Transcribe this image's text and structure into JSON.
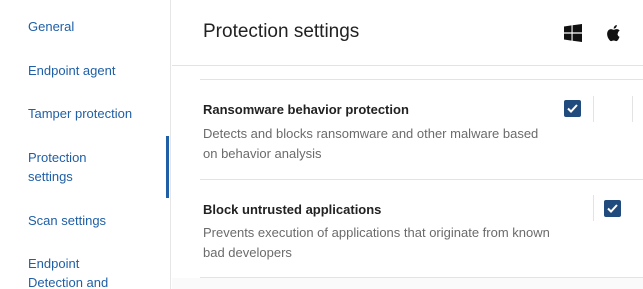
{
  "sidebar": {
    "items": [
      {
        "label": "General"
      },
      {
        "label": "Endpoint agent"
      },
      {
        "label": "Tamper protection"
      },
      {
        "label": "Protection\nsettings",
        "active": true
      },
      {
        "label": "Scan settings"
      },
      {
        "label": "Endpoint\nDetection and"
      }
    ]
  },
  "header": {
    "title": "Protection settings",
    "os_icons": [
      "windows-icon",
      "apple-icon"
    ]
  },
  "settings": [
    {
      "title": "Ransomware behavior protection",
      "description": "Detects and blocks ransomware and other malware based on behavior analysis",
      "checked": true
    },
    {
      "title": "Block untrusted applications",
      "description": "Prevents execution of applications that originate from known bad developers",
      "checked": true
    }
  ],
  "colors": {
    "accent": "#1f5fa6",
    "checkbox": "#204b7c",
    "divider": "#e3e3e3",
    "muted_text": "#6b6b6b"
  }
}
